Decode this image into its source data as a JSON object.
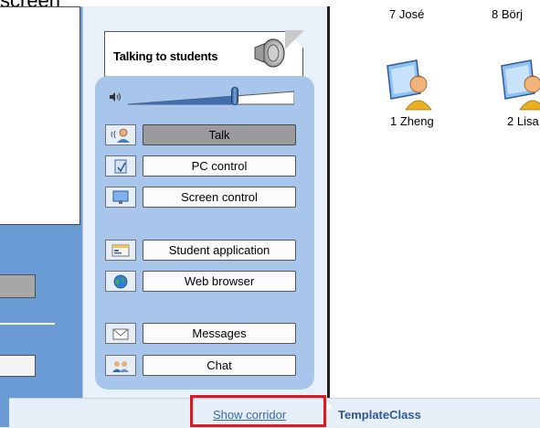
{
  "caption": "screen",
  "card": {
    "title": "Talking to students"
  },
  "menu": {
    "items": [
      {
        "label": "Talk",
        "icon": "talk-icon",
        "active": true
      },
      {
        "label": "PC control",
        "icon": "pc-control-icon",
        "active": false
      },
      {
        "label": "Screen control",
        "icon": "screen-control-icon",
        "active": false
      },
      {
        "label": "Student application",
        "icon": "student-application-icon",
        "active": false
      },
      {
        "label": "Web browser",
        "icon": "web-browser-icon",
        "active": false
      },
      {
        "label": "Messages",
        "icon": "messages-icon",
        "active": false
      },
      {
        "label": "Chat",
        "icon": "chat-icon",
        "active": false
      }
    ]
  },
  "students": {
    "top_row": [
      "7 José",
      "8 Börj"
    ],
    "row": [
      "1 Zheng",
      "2 Lisa"
    ]
  },
  "bottom": {
    "show_corridor": "Show corridor",
    "class_name": "TemplateClass"
  },
  "colors": {
    "accent": "#6a9bd4",
    "menu_bg": "#a8c6ec",
    "highlight_box": "#e6141b",
    "link": "#3668b3"
  }
}
